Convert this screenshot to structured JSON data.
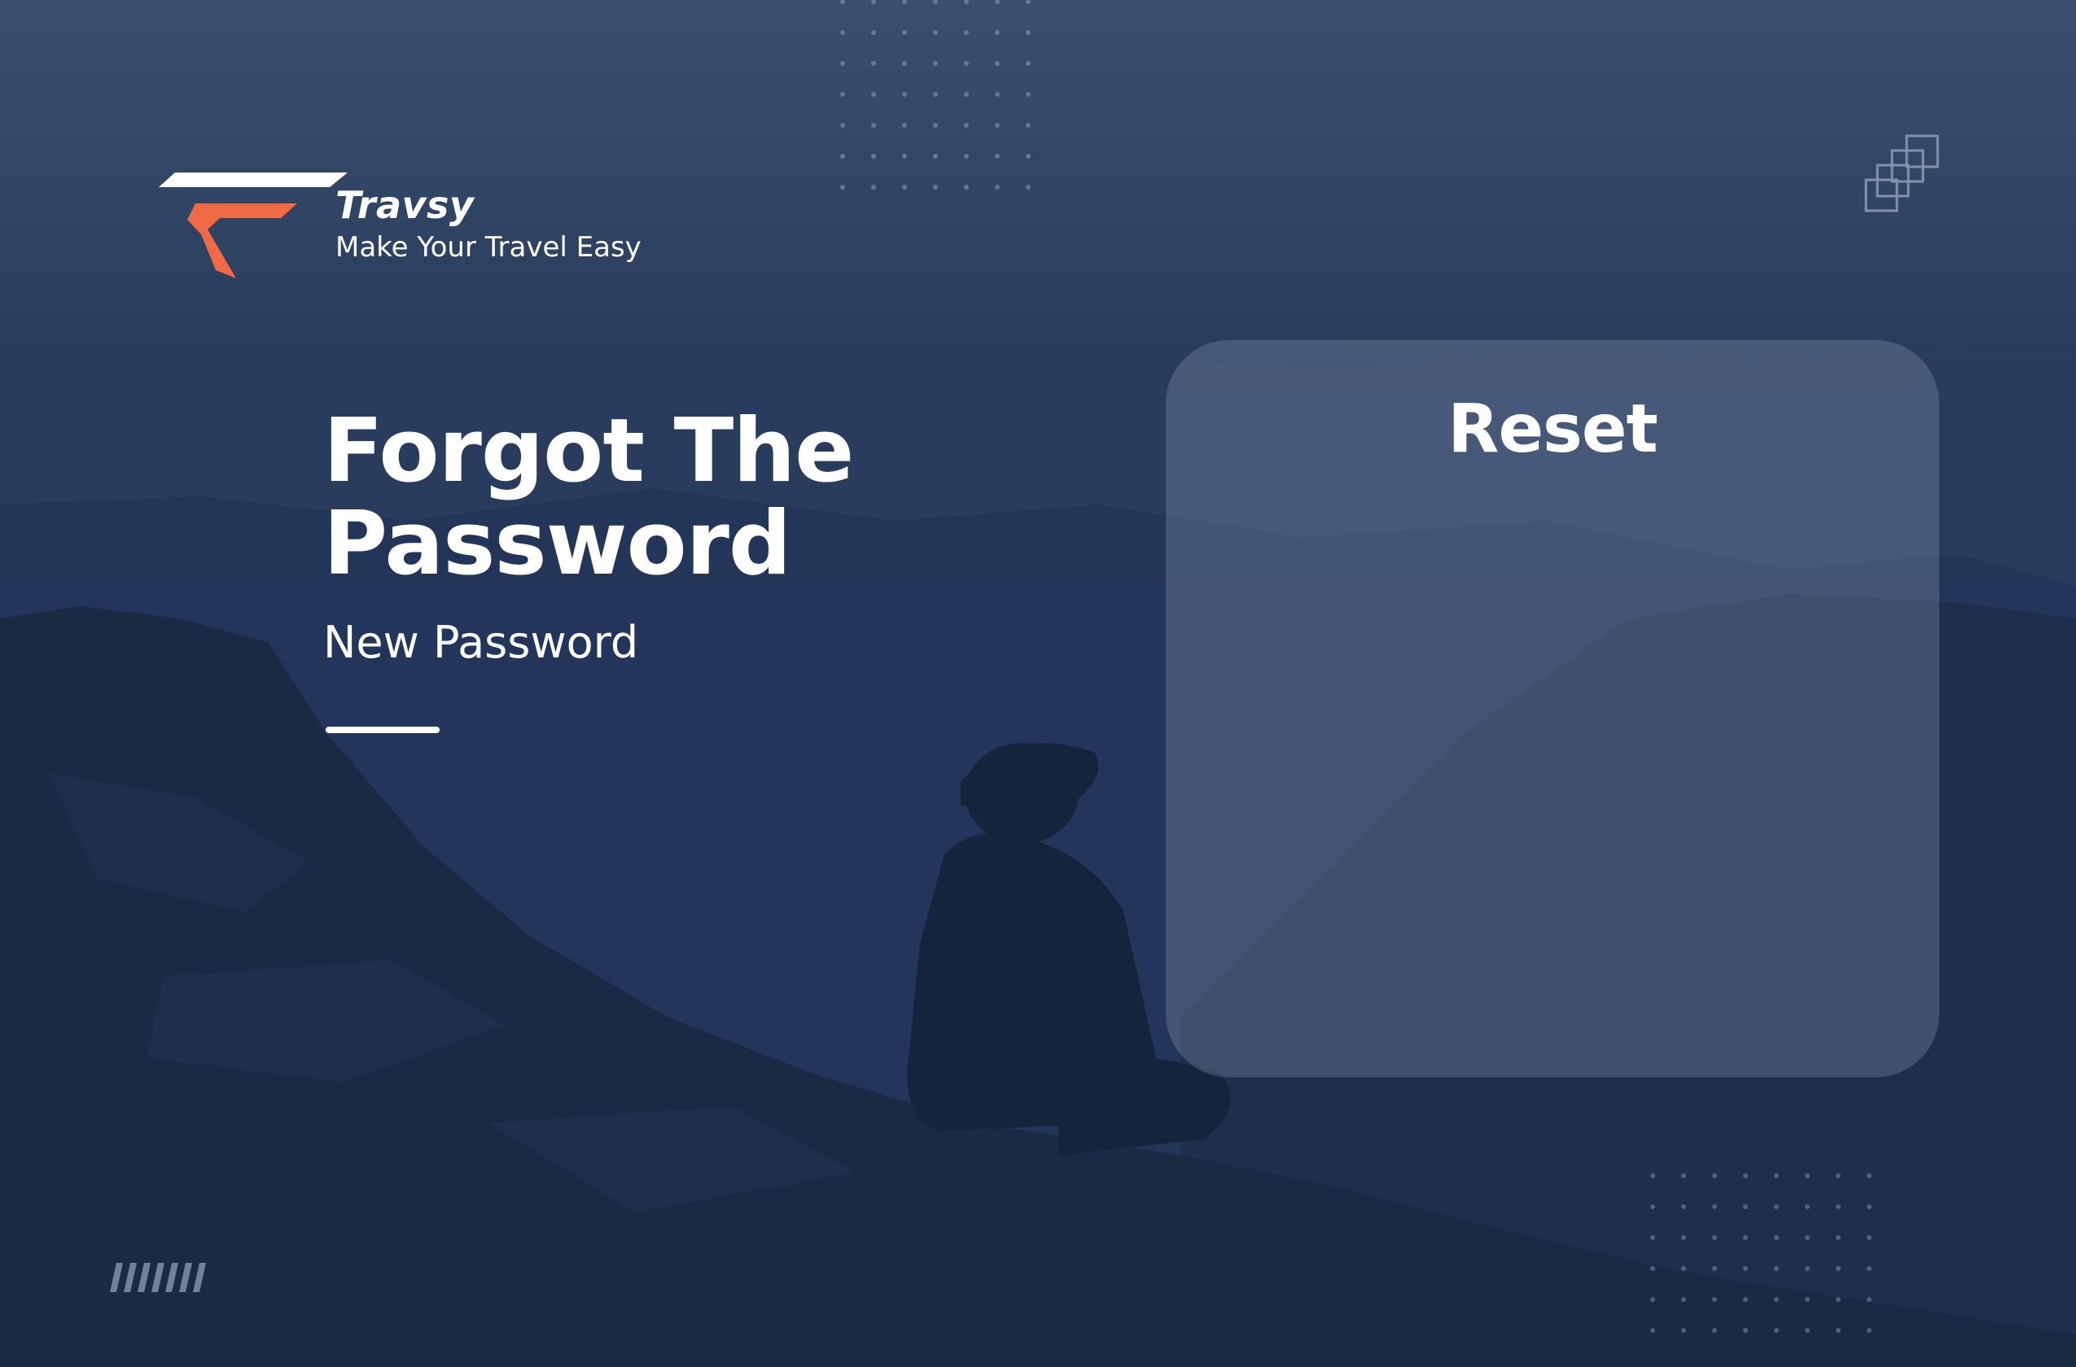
{
  "brand": {
    "name": "Travsy",
    "tagline": "Make Your Travel Easy",
    "logo_icon": "travsy-logo-icon",
    "accent_color": "#ef6a45"
  },
  "hero": {
    "title_line1": "Forgot The",
    "title_line2": "Password",
    "subtitle": "New Password"
  },
  "panel": {
    "title": "Reset"
  },
  "decor": {
    "dot_grid_icon": "dot-grid-icon",
    "stacked_squares_icon": "stacked-squares-icon",
    "stripes_icon": "stripes-icon"
  }
}
